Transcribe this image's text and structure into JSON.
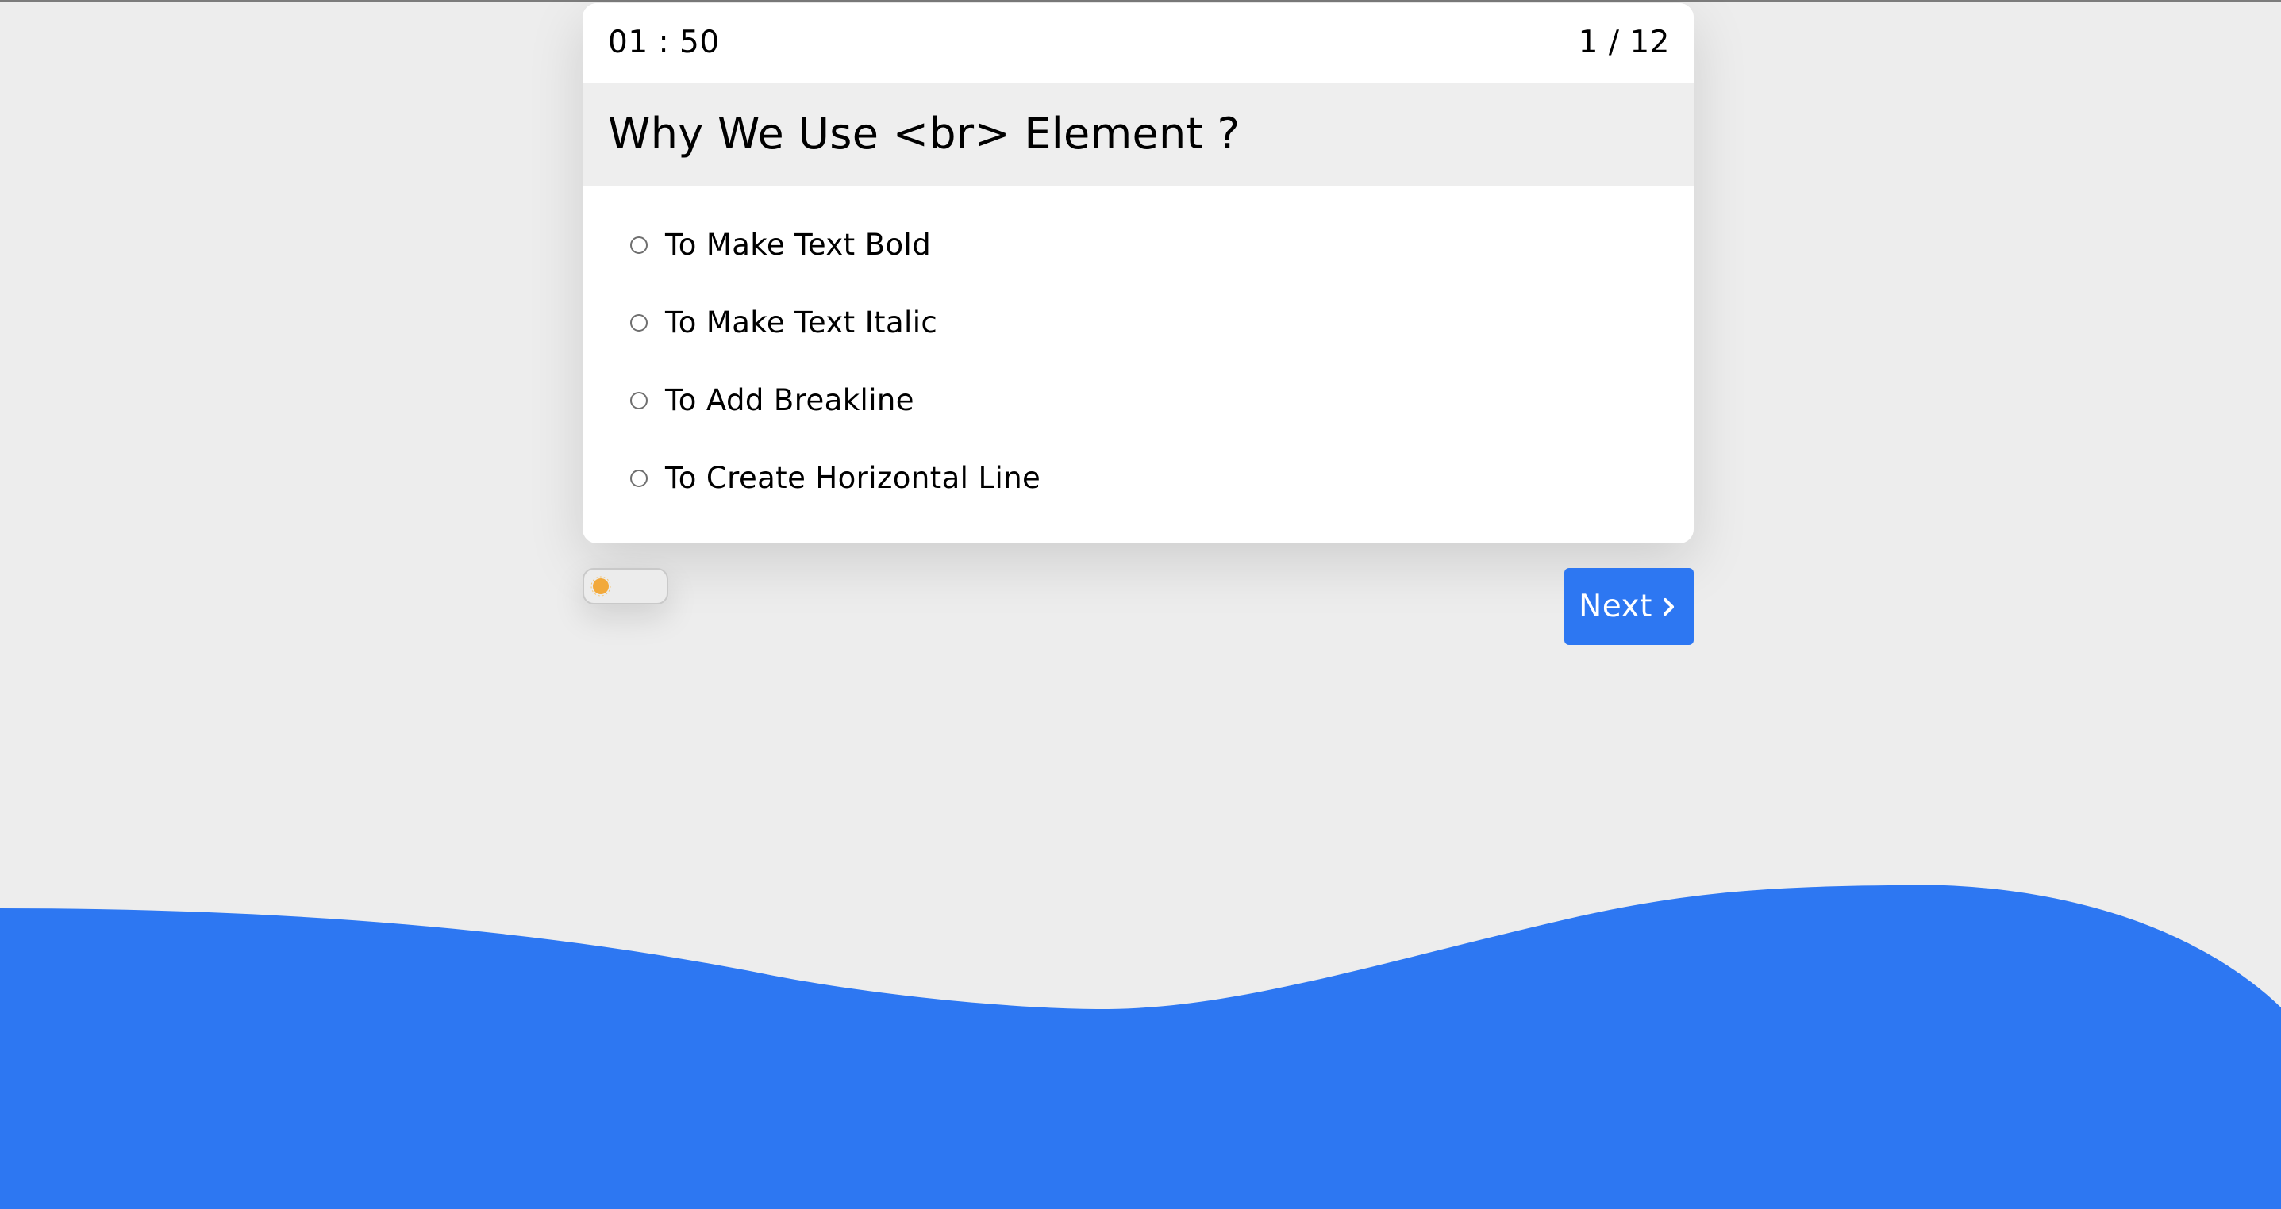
{
  "quiz": {
    "timer": "01 : 50",
    "counter": "1 / 12",
    "question": "Why We Use <br> Element ?",
    "options": [
      {
        "label": "To Make Text Bold",
        "selected": false
      },
      {
        "label": "To Make Text Italic",
        "selected": false
      },
      {
        "label": "To Add Breakline",
        "selected": false
      },
      {
        "label": "To Create Horizontal Line",
        "selected": false
      }
    ]
  },
  "theme_toggle": {
    "icon": "sun-icon",
    "mode": "light"
  },
  "next_button": {
    "label": "Next",
    "icon": "chevron-right-icon"
  },
  "colors": {
    "accent": "#2d77f2",
    "background": "#ededed",
    "card": "#ffffff",
    "question_band": "#eeeeee",
    "sun": "#f2a93b"
  }
}
